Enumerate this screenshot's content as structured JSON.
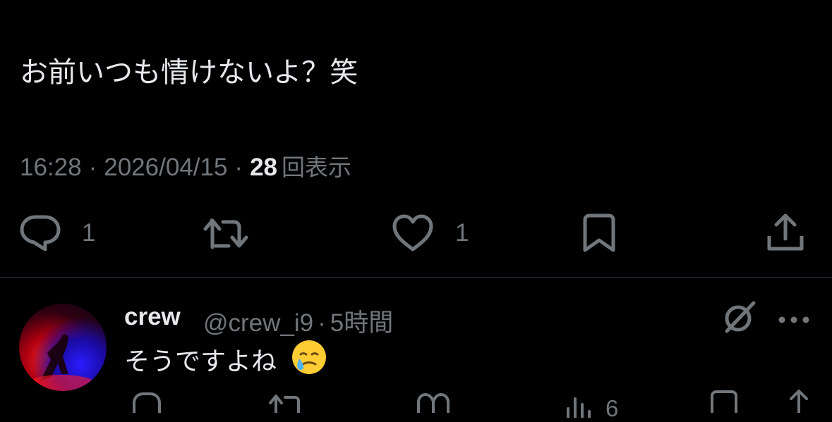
{
  "tweet": {
    "text": "お前いつも情けないよ？笑",
    "time": "16:28",
    "separator": "·",
    "date": "2026/04/15",
    "views_count": "28",
    "views_label": "回表示",
    "actions": {
      "reply_count": "1",
      "like_count": "1"
    }
  },
  "reply": {
    "display_name": "crew",
    "handle": "@crew_i9",
    "separator": "·",
    "time_ago": "5時間",
    "text": "そうですよね",
    "emoji": "face-holding-back-tears",
    "actions": {
      "views_count": "6"
    }
  },
  "colors": {
    "background": "#000000",
    "primary_text": "#e7e9ea",
    "secondary_text": "#71767b",
    "divider": "#2f3336"
  },
  "icons": [
    "reply-icon",
    "retweet-icon",
    "like-icon",
    "bookmark-icon",
    "share-icon",
    "grok-icon",
    "more-icon",
    "views-icon"
  ]
}
